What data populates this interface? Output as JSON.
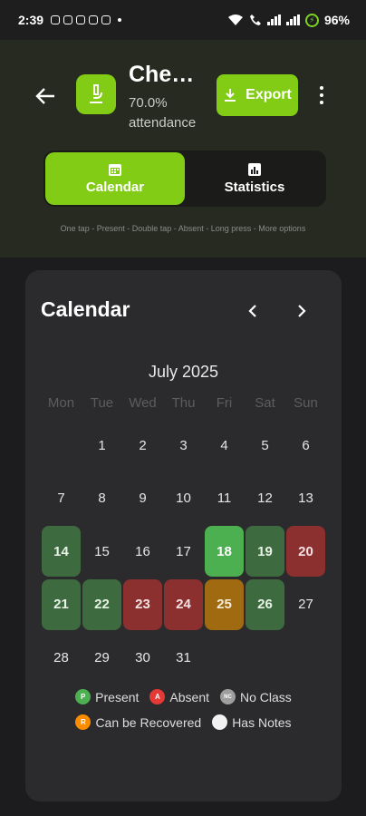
{
  "status_bar": {
    "time": "2:39",
    "battery": "96%"
  },
  "header": {
    "subject_name": "Chem…",
    "attendance_percent": "70.0%",
    "attendance_label": "attendance",
    "export_label": "Export",
    "tabs": [
      {
        "label": "Calendar",
        "icon": "calendar-icon",
        "active": true
      },
      {
        "label": "Statistics",
        "icon": "bar-chart-icon",
        "active": false
      }
    ],
    "hint": "One tap - Present - Double tap - Absent - Long press - More options",
    "accent_color": "#82cc16"
  },
  "calendar": {
    "title": "Calendar",
    "month": "July 2025",
    "weekdays": [
      "Mon",
      "Tue",
      "Wed",
      "Thu",
      "Fri",
      "Sat",
      "Sun"
    ],
    "leading_blanks": 1,
    "days": [
      {
        "d": "1",
        "s": ""
      },
      {
        "d": "2",
        "s": ""
      },
      {
        "d": "3",
        "s": ""
      },
      {
        "d": "4",
        "s": ""
      },
      {
        "d": "5",
        "s": ""
      },
      {
        "d": "6",
        "s": ""
      },
      {
        "d": "7",
        "s": ""
      },
      {
        "d": "8",
        "s": ""
      },
      {
        "d": "9",
        "s": ""
      },
      {
        "d": "10",
        "s": ""
      },
      {
        "d": "11",
        "s": ""
      },
      {
        "d": "12",
        "s": ""
      },
      {
        "d": "13",
        "s": ""
      },
      {
        "d": "14",
        "s": "present"
      },
      {
        "d": "15",
        "s": ""
      },
      {
        "d": "16",
        "s": ""
      },
      {
        "d": "17",
        "s": ""
      },
      {
        "d": "18",
        "s": "today"
      },
      {
        "d": "19",
        "s": "present"
      },
      {
        "d": "20",
        "s": "absent"
      },
      {
        "d": "21",
        "s": "present"
      },
      {
        "d": "22",
        "s": "present"
      },
      {
        "d": "23",
        "s": "absent"
      },
      {
        "d": "24",
        "s": "absent"
      },
      {
        "d": "25",
        "s": "recoverable"
      },
      {
        "d": "26",
        "s": "present"
      },
      {
        "d": "27",
        "s": ""
      },
      {
        "d": "28",
        "s": ""
      },
      {
        "d": "29",
        "s": ""
      },
      {
        "d": "30",
        "s": ""
      },
      {
        "d": "31",
        "s": ""
      }
    ],
    "status_colors": {
      "present": "#3d6b3f",
      "absent": "#8b2f2f",
      "recoverable": "#a06a10",
      "today": "#4caf50"
    }
  },
  "legend": [
    {
      "label": "Present",
      "badge": "P",
      "color": "#4caf50"
    },
    {
      "label": "Absent",
      "badge": "A",
      "color": "#e53935"
    },
    {
      "label": "No Class",
      "badge": "NC",
      "color": "#9e9e9e"
    },
    {
      "label": "Can be Recovered",
      "badge": "R",
      "color": "#fb8c00"
    },
    {
      "label": "Has Notes",
      "badge": "",
      "color": "#f2f2f2"
    }
  ]
}
